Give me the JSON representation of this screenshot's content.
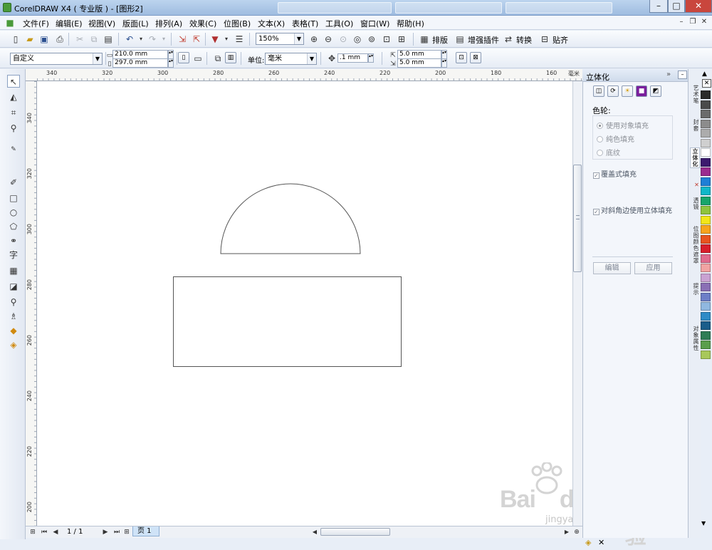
{
  "title": "CorelDRAW X4 ( 专业版 ) - [图形2]",
  "menus": [
    "文件(F)",
    "编辑(E)",
    "视图(V)",
    "版面(L)",
    "排列(A)",
    "效果(C)",
    "位图(B)",
    "文本(X)",
    "表格(T)",
    "工具(O)",
    "窗口(W)",
    "帮助(H)"
  ],
  "toolbar": {
    "zoom": "150%",
    "arrange": "排版",
    "plugin": "增强插件",
    "convert": "转换",
    "paste": "贴齐"
  },
  "prop": {
    "preset": "自定义",
    "width": "210.0 mm",
    "height": "297.0 mm",
    "unit_label": "单位:",
    "unit": "毫米",
    "nudge": ".1 mm",
    "dup_x": "5.0 mm",
    "dup_y": "5.0 mm"
  },
  "ruler": {
    "h_unit": "毫米",
    "h": [
      "340",
      "320",
      "300",
      "280",
      "260",
      "240",
      "220",
      "200",
      "180",
      "160"
    ],
    "v": [
      "340",
      "320",
      "300",
      "280",
      "260",
      "240",
      "220",
      "200"
    ]
  },
  "status": {
    "page_count": "1 / 1",
    "page_tab": "页 1"
  },
  "docker": {
    "title": "立体化",
    "wheel_label": "色轮:",
    "opt1": "使用对象填充",
    "opt2": "纯色填充",
    "opt3": "底纹",
    "overprint": "覆盖式填充",
    "bevel": "对斜角边使用立体填充",
    "edit": "编辑",
    "apply": "应用"
  },
  "tabs": [
    "艺术笔",
    "封套",
    "立体化",
    "透镜",
    "位图颜色遮罩",
    "提示",
    "对象属性"
  ],
  "watermark": {
    "brand": "Bai",
    "brand2": "du",
    "cn": "经验",
    "url": "jingyan.baidu.com"
  },
  "palette": [
    "#2b2b2b",
    "#4a4a4a",
    "#6b6b6b",
    "#8c8c8c",
    "#acacac",
    "#cfcfcf",
    "#ffffff",
    "#3c1a6e",
    "#9b2b8f",
    "#1f7fd6",
    "#10b7c9",
    "#18a56b",
    "#8fc43e",
    "#f2e61a",
    "#f7a41d",
    "#e8541f",
    "#d81e2c",
    "#e06a8d",
    "#f1a3a3",
    "#c9a2d2",
    "#8a6fb5",
    "#6d7fc7",
    "#90b8e0",
    "#2f8bc6",
    "#1a5d8a",
    "#2e7d55",
    "#5a9e4c",
    "#a8c85a"
  ]
}
